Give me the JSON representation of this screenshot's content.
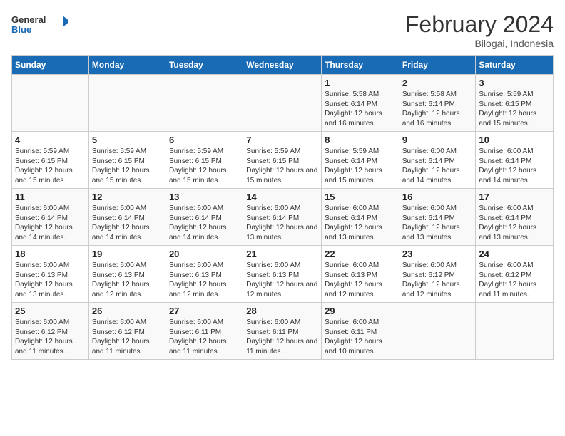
{
  "logo": {
    "line1": "General",
    "line2": "Blue"
  },
  "title": "February 2024",
  "subtitle": "Bilogai, Indonesia",
  "days_of_week": [
    "Sunday",
    "Monday",
    "Tuesday",
    "Wednesday",
    "Thursday",
    "Friday",
    "Saturday"
  ],
  "weeks": [
    [
      {
        "day": "",
        "info": ""
      },
      {
        "day": "",
        "info": ""
      },
      {
        "day": "",
        "info": ""
      },
      {
        "day": "",
        "info": ""
      },
      {
        "day": "1",
        "info": "Sunrise: 5:58 AM\nSunset: 6:14 PM\nDaylight: 12 hours and 16 minutes."
      },
      {
        "day": "2",
        "info": "Sunrise: 5:58 AM\nSunset: 6:14 PM\nDaylight: 12 hours and 16 minutes."
      },
      {
        "day": "3",
        "info": "Sunrise: 5:59 AM\nSunset: 6:15 PM\nDaylight: 12 hours and 15 minutes."
      }
    ],
    [
      {
        "day": "4",
        "info": "Sunrise: 5:59 AM\nSunset: 6:15 PM\nDaylight: 12 hours and 15 minutes."
      },
      {
        "day": "5",
        "info": "Sunrise: 5:59 AM\nSunset: 6:15 PM\nDaylight: 12 hours and 15 minutes."
      },
      {
        "day": "6",
        "info": "Sunrise: 5:59 AM\nSunset: 6:15 PM\nDaylight: 12 hours and 15 minutes."
      },
      {
        "day": "7",
        "info": "Sunrise: 5:59 AM\nSunset: 6:15 PM\nDaylight: 12 hours and 15 minutes."
      },
      {
        "day": "8",
        "info": "Sunrise: 5:59 AM\nSunset: 6:14 PM\nDaylight: 12 hours and 15 minutes."
      },
      {
        "day": "9",
        "info": "Sunrise: 6:00 AM\nSunset: 6:14 PM\nDaylight: 12 hours and 14 minutes."
      },
      {
        "day": "10",
        "info": "Sunrise: 6:00 AM\nSunset: 6:14 PM\nDaylight: 12 hours and 14 minutes."
      }
    ],
    [
      {
        "day": "11",
        "info": "Sunrise: 6:00 AM\nSunset: 6:14 PM\nDaylight: 12 hours and 14 minutes."
      },
      {
        "day": "12",
        "info": "Sunrise: 6:00 AM\nSunset: 6:14 PM\nDaylight: 12 hours and 14 minutes."
      },
      {
        "day": "13",
        "info": "Sunrise: 6:00 AM\nSunset: 6:14 PM\nDaylight: 12 hours and 14 minutes."
      },
      {
        "day": "14",
        "info": "Sunrise: 6:00 AM\nSunset: 6:14 PM\nDaylight: 12 hours and 13 minutes."
      },
      {
        "day": "15",
        "info": "Sunrise: 6:00 AM\nSunset: 6:14 PM\nDaylight: 12 hours and 13 minutes."
      },
      {
        "day": "16",
        "info": "Sunrise: 6:00 AM\nSunset: 6:14 PM\nDaylight: 12 hours and 13 minutes."
      },
      {
        "day": "17",
        "info": "Sunrise: 6:00 AM\nSunset: 6:14 PM\nDaylight: 12 hours and 13 minutes."
      }
    ],
    [
      {
        "day": "18",
        "info": "Sunrise: 6:00 AM\nSunset: 6:13 PM\nDaylight: 12 hours and 13 minutes."
      },
      {
        "day": "19",
        "info": "Sunrise: 6:00 AM\nSunset: 6:13 PM\nDaylight: 12 hours and 12 minutes."
      },
      {
        "day": "20",
        "info": "Sunrise: 6:00 AM\nSunset: 6:13 PM\nDaylight: 12 hours and 12 minutes."
      },
      {
        "day": "21",
        "info": "Sunrise: 6:00 AM\nSunset: 6:13 PM\nDaylight: 12 hours and 12 minutes."
      },
      {
        "day": "22",
        "info": "Sunrise: 6:00 AM\nSunset: 6:13 PM\nDaylight: 12 hours and 12 minutes."
      },
      {
        "day": "23",
        "info": "Sunrise: 6:00 AM\nSunset: 6:12 PM\nDaylight: 12 hours and 12 minutes."
      },
      {
        "day": "24",
        "info": "Sunrise: 6:00 AM\nSunset: 6:12 PM\nDaylight: 12 hours and 11 minutes."
      }
    ],
    [
      {
        "day": "25",
        "info": "Sunrise: 6:00 AM\nSunset: 6:12 PM\nDaylight: 12 hours and 11 minutes."
      },
      {
        "day": "26",
        "info": "Sunrise: 6:00 AM\nSunset: 6:12 PM\nDaylight: 12 hours and 11 minutes."
      },
      {
        "day": "27",
        "info": "Sunrise: 6:00 AM\nSunset: 6:11 PM\nDaylight: 12 hours and 11 minutes."
      },
      {
        "day": "28",
        "info": "Sunrise: 6:00 AM\nSunset: 6:11 PM\nDaylight: 12 hours and 11 minutes."
      },
      {
        "day": "29",
        "info": "Sunrise: 6:00 AM\nSunset: 6:11 PM\nDaylight: 12 hours and 10 minutes."
      },
      {
        "day": "",
        "info": ""
      },
      {
        "day": "",
        "info": ""
      }
    ]
  ]
}
